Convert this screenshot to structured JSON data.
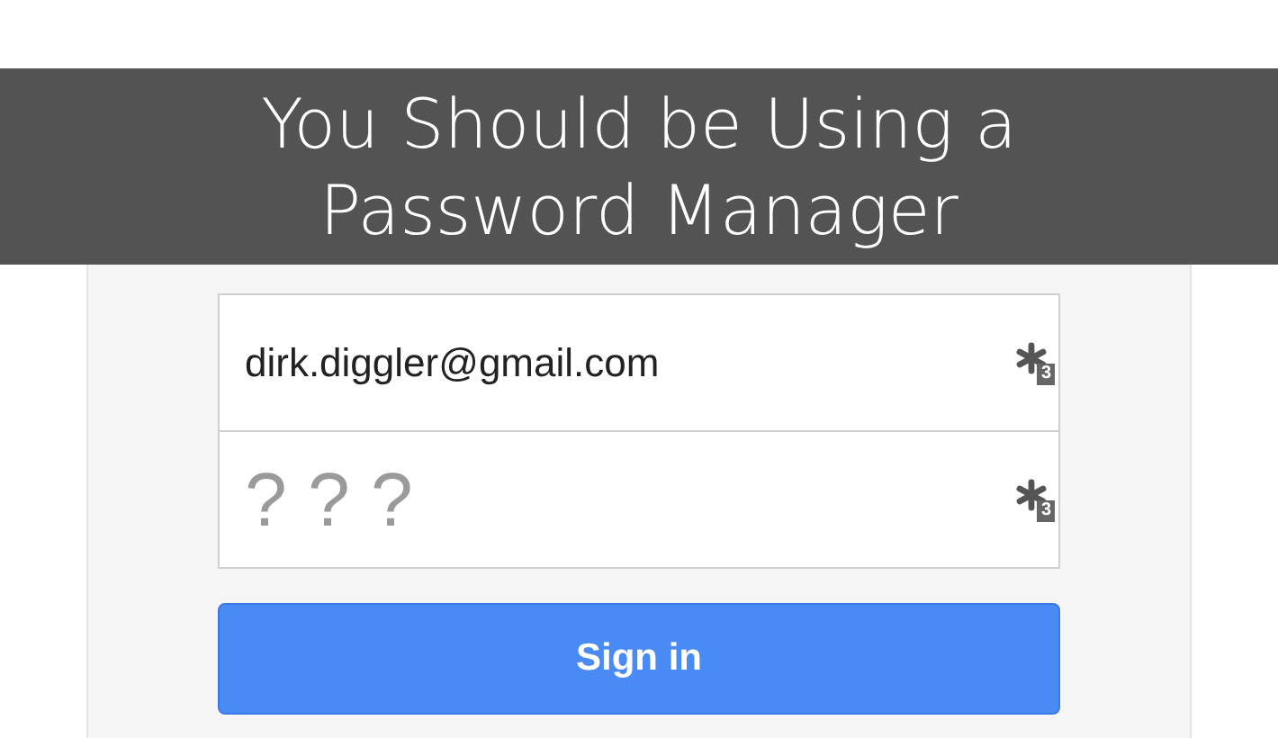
{
  "banner": {
    "title": "You Should be Using a Password Manager"
  },
  "form": {
    "fields": [
      {
        "kind": "email",
        "value": "dirk.diggler@gmail.com",
        "badge": "3"
      },
      {
        "kind": "password",
        "value": "? ? ?",
        "badge": "3"
      }
    ],
    "button": "Sign in"
  }
}
